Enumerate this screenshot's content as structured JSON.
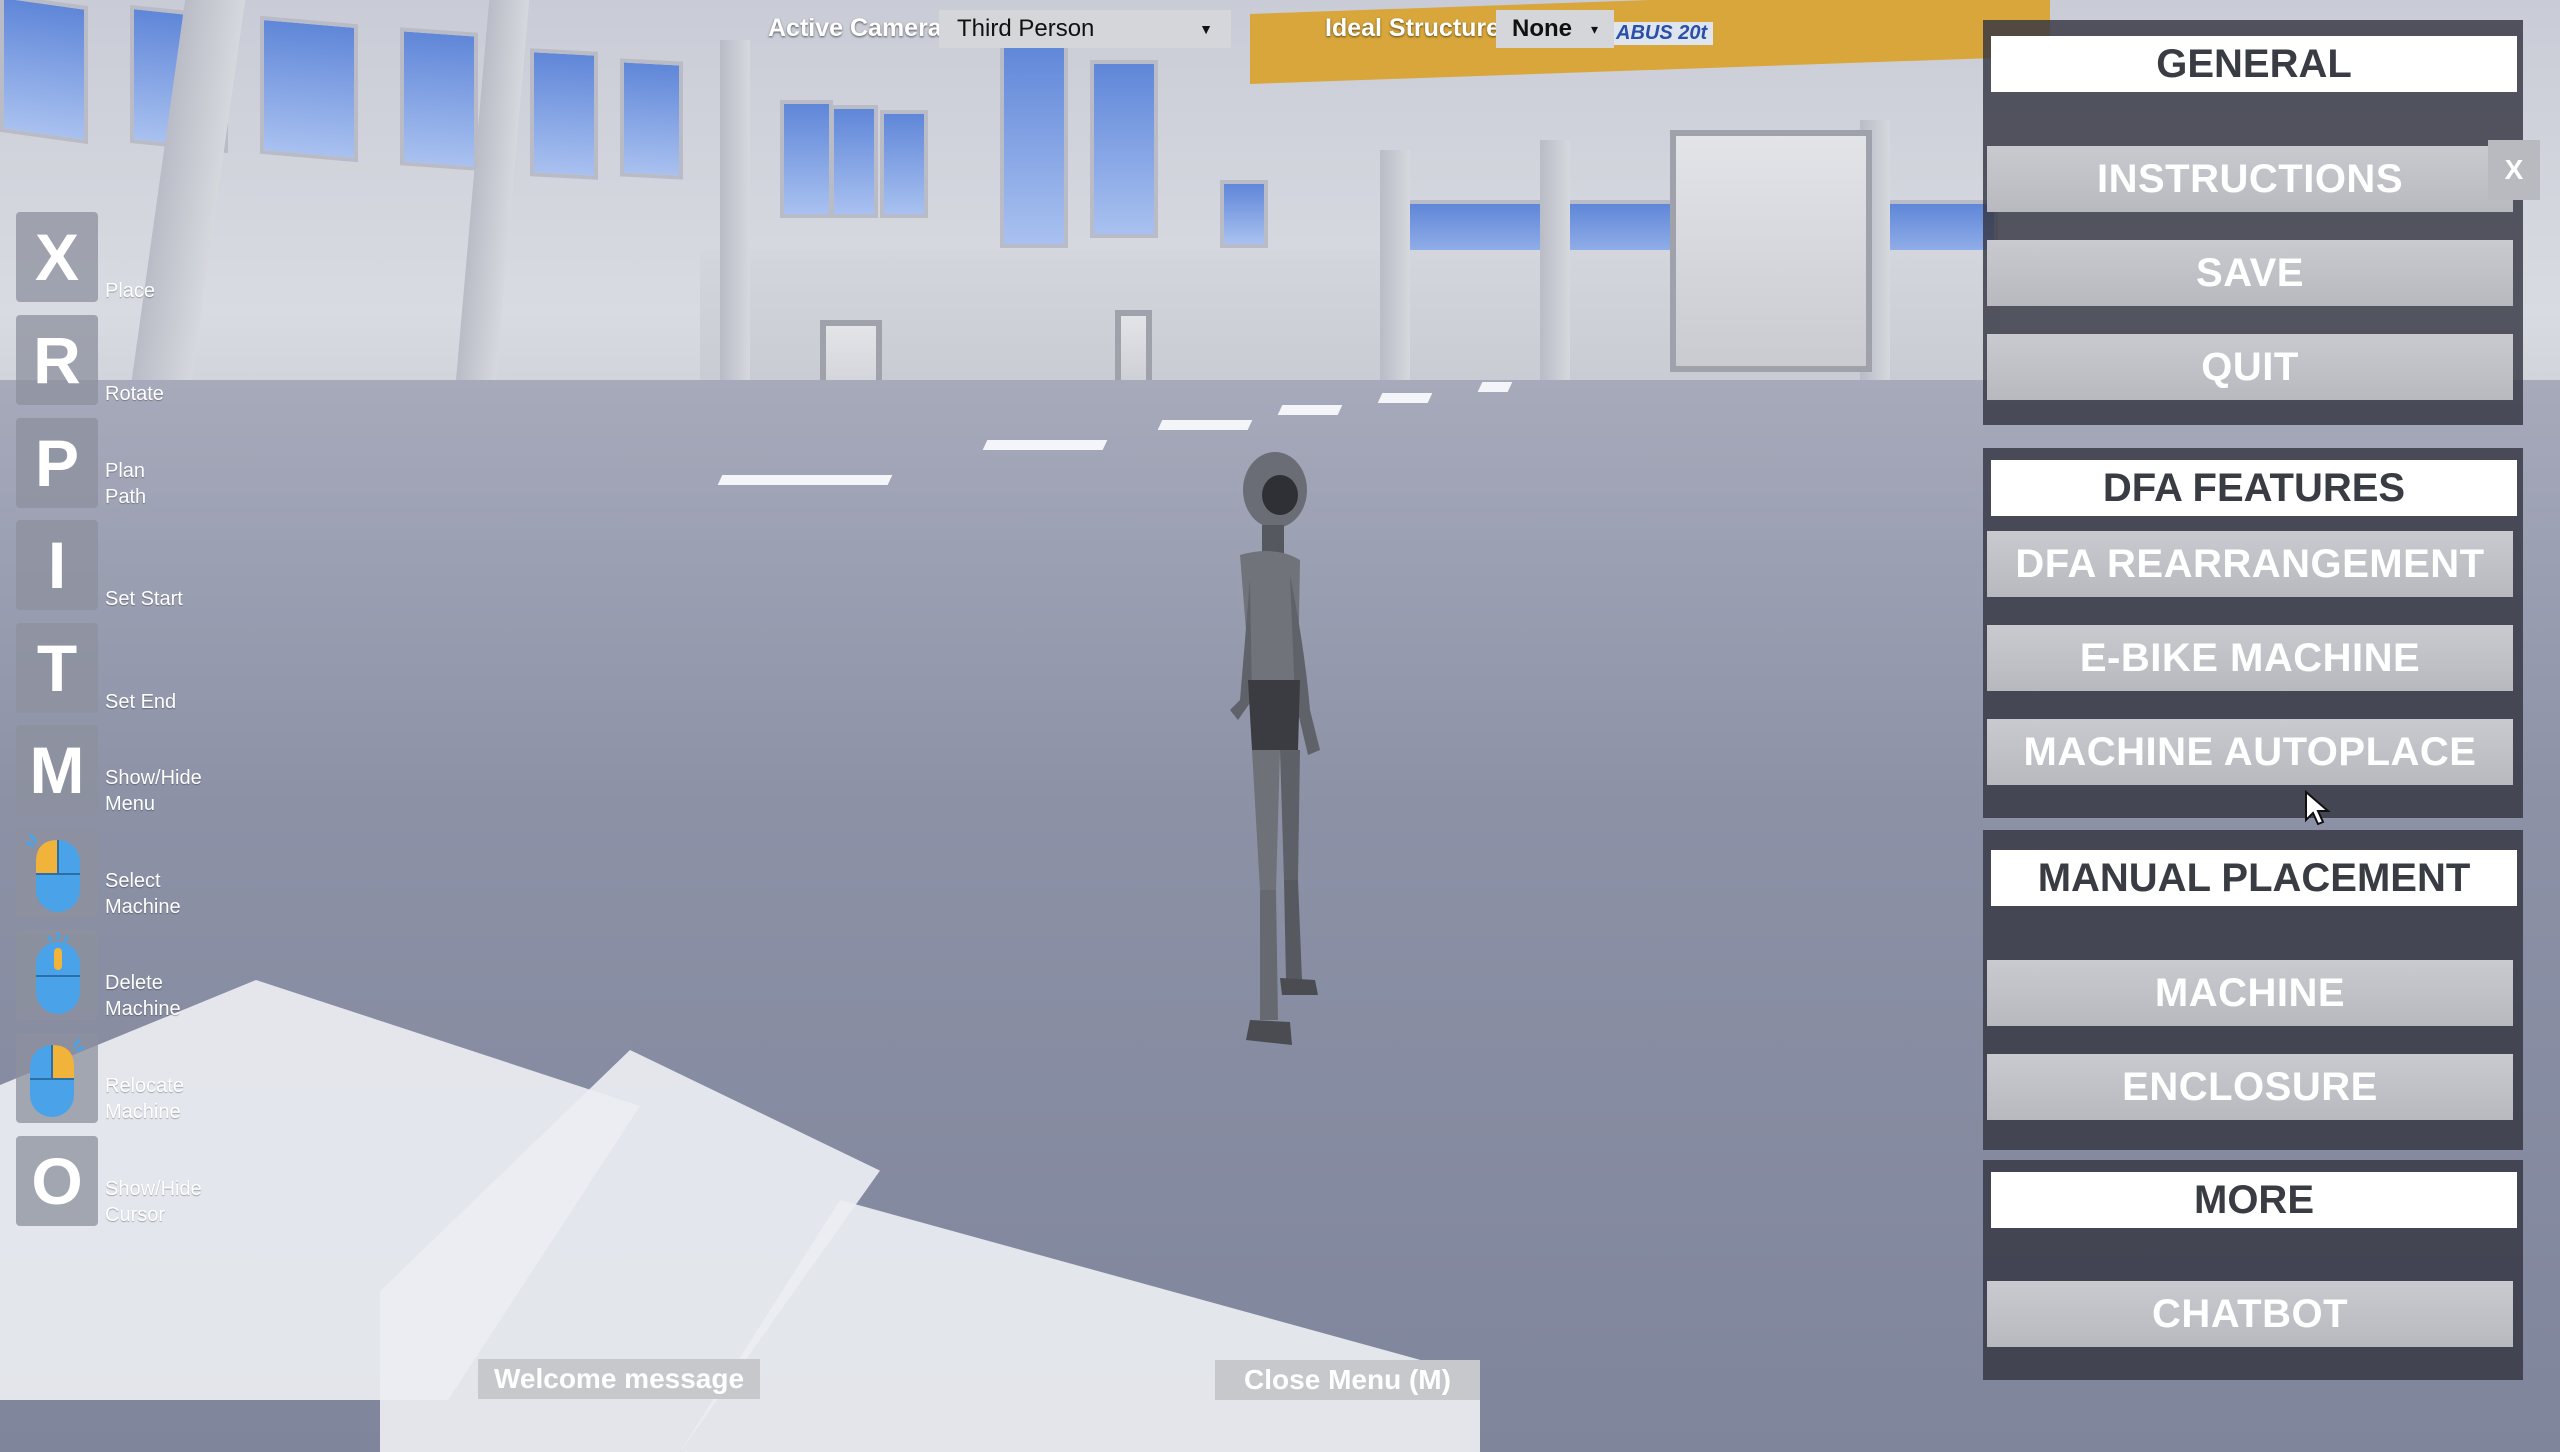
{
  "topbar": {
    "camera_label": "Active Camera",
    "camera_value": "Third Person",
    "structure_label": "Ideal Structure",
    "structure_value": "None"
  },
  "hotkeys": [
    {
      "key": "X",
      "label": "Place"
    },
    {
      "key": "R",
      "label": "Rotate"
    },
    {
      "key": "P",
      "label": "Plan\nPath"
    },
    {
      "key": "I",
      "label": "Set Start"
    },
    {
      "key": "T",
      "label": "Set End"
    },
    {
      "key": "M",
      "label": "Show/Hide\nMenu"
    },
    {
      "key": "mouse-left-icon",
      "label": "Select\nMachine"
    },
    {
      "key": "mouse-middle-icon",
      "label": "Delete\nMachine"
    },
    {
      "key": "mouse-right-icon",
      "label": "Relocate\nMachine"
    },
    {
      "key": "O",
      "label": "Show/Hide\nCursor"
    }
  ],
  "menu": {
    "general": {
      "header": "GENERAL",
      "close": "X",
      "instructions": "INSTRUCTIONS",
      "save": "SAVE",
      "quit": "QUIT"
    },
    "dfa": {
      "header": "DFA FEATURES",
      "rearrangement": "DFA REARRANGEMENT",
      "ebike": "E-BIKE MACHINE",
      "autoplace": "MACHINE AUTOPLACE"
    },
    "manual": {
      "header": "MANUAL PLACEMENT",
      "machine": "MACHINE",
      "enclosure": "ENCLOSURE"
    },
    "more": {
      "header": "MORE",
      "chatbot": "CHATBOT"
    }
  },
  "bottom": {
    "welcome": "Welcome message",
    "close_menu": "Close Menu (M)"
  },
  "scene": {
    "crane_label": "ABUS 20t"
  },
  "colors": {
    "menu_panel": "#343642",
    "button": "#c0c1c6",
    "mouse_blue": "#4aa3e8",
    "mouse_orange": "#f2b33a"
  }
}
